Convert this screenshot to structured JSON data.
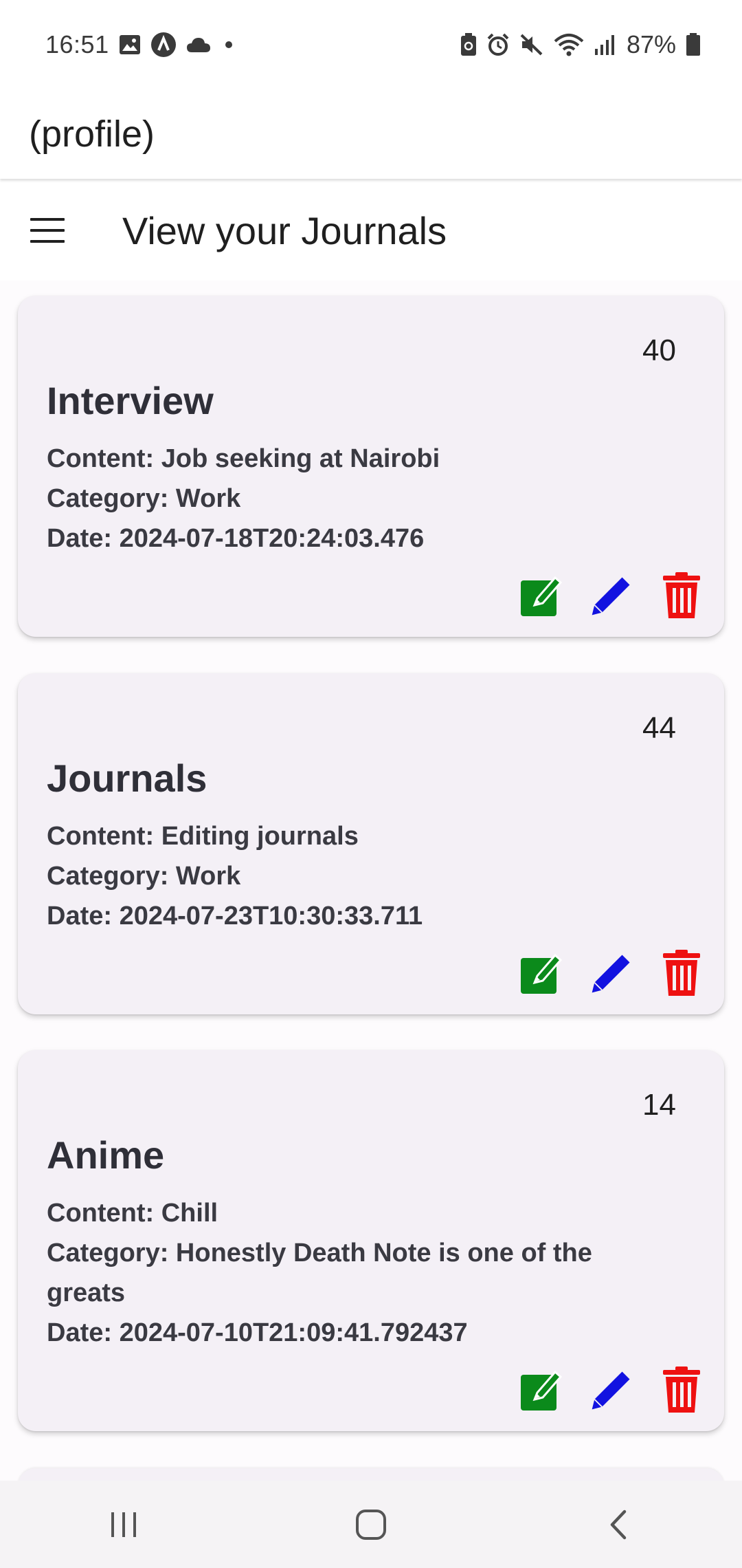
{
  "status_bar": {
    "time": "16:51",
    "battery": "87%",
    "left_icons": [
      "image-icon",
      "app-a-icon",
      "cloud-icon",
      "dot-icon"
    ],
    "right_icons": [
      "battery-saver-icon",
      "alarm-icon",
      "mute-icon",
      "wifi-icon",
      "signal-icon",
      "battery-icon"
    ]
  },
  "app_bar": {
    "title": "(profile)"
  },
  "header": {
    "menu_icon": "hamburger-menu-icon",
    "title": "View your Journals"
  },
  "journals": [
    {
      "number": "40",
      "title": "Interview",
      "content": "Content: Job seeking at Nairobi",
      "category": "Category: Work",
      "date": "Date: 2024-07-18T20:24:03.476"
    },
    {
      "number": "44",
      "title": "Journals",
      "content": "Content: Editing journals",
      "category": "Category: Work",
      "date": "Date: 2024-07-23T10:30:33.711"
    },
    {
      "number": "14",
      "title": "Anime",
      "content": "Content: Chill",
      "category": "Category: Honestly Death Note is one of the greats",
      "date": "Date: 2024-07-10T21:09:41.792437"
    }
  ],
  "colors": {
    "view_action": "#0b8a1b",
    "edit_action": "#1212e0",
    "delete_action": "#ee1111",
    "card_bg": "#f4f0f6"
  },
  "nav_bar": {
    "icons": [
      "recent-apps-icon",
      "home-icon",
      "back-icon"
    ]
  }
}
